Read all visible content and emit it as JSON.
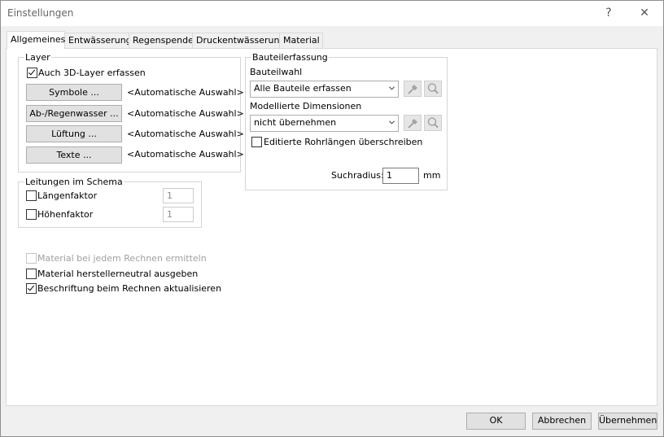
{
  "window": {
    "title": "Einstellungen",
    "help_glyph": "?",
    "close_glyph": "✕"
  },
  "tabs": [
    {
      "label": "Allgemeines",
      "active": true
    },
    {
      "label": "Entwässerung",
      "active": false
    },
    {
      "label": "Regenspende",
      "active": false
    },
    {
      "label": "Druckentwässerung",
      "active": false
    },
    {
      "label": "Material",
      "active": false
    }
  ],
  "layer": {
    "group_title": "Layer",
    "also_3d": {
      "label": "Auch 3D-Layer erfassen",
      "checked": true
    },
    "rows": [
      {
        "button": "Symbole ...",
        "value": "<Automatische Auswahl>"
      },
      {
        "button": "Ab-/Regenwasser ...",
        "value": "<Automatische Auswahl>"
      },
      {
        "button": "Lüftung ...",
        "value": "<Automatische Auswahl>"
      },
      {
        "button": "Texte ...",
        "value": "<Automatische Auswahl>"
      }
    ]
  },
  "schema": {
    "group_title": "Leitungen im Schema",
    "length_factor": {
      "label": "Längenfaktor",
      "checked": false,
      "value": "1"
    },
    "height_factor": {
      "label": "Höhenfaktor",
      "checked": false,
      "value": "1"
    }
  },
  "options": {
    "material_each": {
      "label": "Material bei jedem Rechnen ermitteln",
      "checked": false,
      "disabled": true
    },
    "material_neutral": {
      "label": "Material herstellerneutral ausgeben",
      "checked": false
    },
    "update_labels": {
      "label": "Beschriftung beim Rechnen aktualisieren",
      "checked": true
    }
  },
  "component": {
    "group_title": "Bauteilerfassung",
    "selection_label": "Bauteilwahl",
    "selection_value": "Alle Bauteile erfassen",
    "dimensions_label": "Modellierte Dimensionen",
    "dimensions_value": "nicht übernehmen",
    "overwrite_lengths": {
      "label": "Editierte Rohrlängen überschreiben",
      "checked": false
    },
    "search_radius_label": "Suchradius:",
    "search_radius_value": "1",
    "search_radius_unit": "mm"
  },
  "footer": {
    "ok": "OK",
    "cancel": "Abbrechen",
    "apply": "Übernehmen"
  },
  "colors": {
    "panel": "#ffffff",
    "dialog": "#f0f0f0",
    "button": "#e1e1e1",
    "border": "#adadad"
  }
}
